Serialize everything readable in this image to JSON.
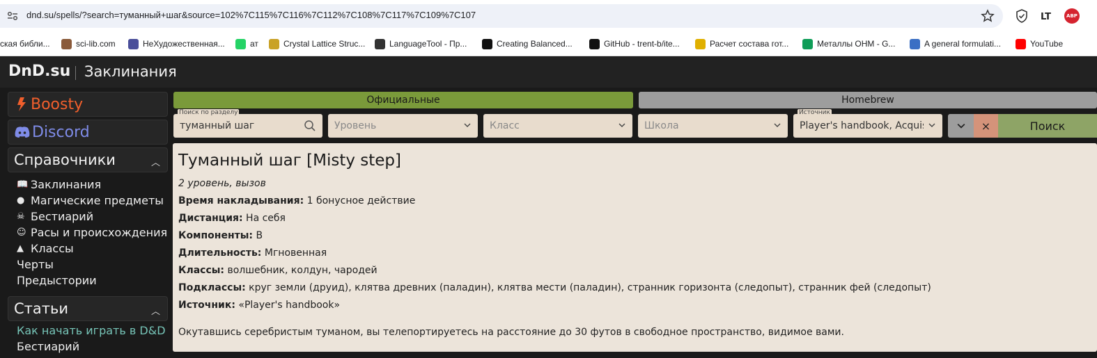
{
  "browser": {
    "url": "dnd.su/spells/?search=туманный+шаг&source=102%7C115%7C116%7C112%7C108%7C117%7C109%7C107",
    "ext_abp": "ABP",
    "bookmarks": [
      {
        "label": "ская библи...",
        "icon": "book-icon",
        "color": "#5b6e86"
      },
      {
        "label": "sci-lib.com",
        "icon": "scilib-icon",
        "color": "#8a5a3a"
      },
      {
        "label": "НеХудожественная...",
        "icon": "nh-icon",
        "color": "#4a4f9a"
      },
      {
        "label": "ат",
        "icon": "whatsapp-icon",
        "color": "#25d366"
      },
      {
        "label": "Crystal Lattice Struc...",
        "icon": "crystal-icon",
        "color": "#c9a227"
      },
      {
        "label": "LanguageTool - Пр...",
        "icon": "languagetool-icon",
        "color": "#333333"
      },
      {
        "label": "Creating Balanced...",
        "icon": "medium-icon",
        "color": "#111111"
      },
      {
        "label": "GitHub - trent-b/ite...",
        "icon": "github-icon",
        "color": "#111111"
      },
      {
        "label": "Расчет состава гот...",
        "icon": "calc-icon",
        "color": "#e0b000"
      },
      {
        "label": "Металлы ОНМ - G...",
        "icon": "sheets-icon",
        "color": "#0f9d58"
      },
      {
        "label": "A general formulati...",
        "icon": "paper-icon",
        "color": "#3b6fc4"
      },
      {
        "label": "YouTube",
        "icon": "youtube-icon",
        "color": "#ff0000"
      }
    ]
  },
  "site": {
    "logo": "DnD.su",
    "page_title": "Заклинания"
  },
  "sidebar": {
    "boosty": "Boosty",
    "discord": "Discord",
    "reference_title": "Справочники",
    "reference_items": [
      {
        "label": "Заклинания",
        "icon": "book-icon"
      },
      {
        "label": "Магические предметы",
        "icon": "potion-icon"
      },
      {
        "label": "Бестиарий",
        "icon": "skull-icon"
      },
      {
        "label": "Расы и происхождения",
        "icon": "race-icon"
      },
      {
        "label": "Классы",
        "icon": "helmet-icon"
      },
      {
        "label": "Черты",
        "icon": ""
      },
      {
        "label": "Предыстории",
        "icon": ""
      }
    ],
    "articles_title": "Статьи",
    "articles_items": [
      {
        "label": "Как начать играть в D&D",
        "accent": true
      },
      {
        "label": "Бестиарий",
        "accent": false
      }
    ]
  },
  "main": {
    "tabs": {
      "official": "Официальные",
      "homebrew": "Homebrew"
    },
    "filters": {
      "search_label": "Поиск по разделу",
      "search_value": "туманный шаг",
      "level_placeholder": "Уровень",
      "class_placeholder": "Класс",
      "school_placeholder": "Школа",
      "source_label": "Источник",
      "source_value": "Player's handbook, Acquisit"
    },
    "buttons": {
      "clear": "×",
      "search": "Поиск"
    },
    "spell": {
      "title": "Туманный шаг [Misty step]",
      "meta": "2 уровень, вызов",
      "props": [
        {
          "label": "Время накладывания:",
          "value": "1 бонусное действие"
        },
        {
          "label": "Дистанция:",
          "value": "На себя"
        },
        {
          "label": "Компоненты:",
          "value": "В"
        },
        {
          "label": "Длительность:",
          "value": "Мгновенная"
        },
        {
          "label": "Классы:",
          "value": "волшебник, колдун, чародей"
        },
        {
          "label": "Подклассы:",
          "value": "круг земли (друид), клятва древних (паладин), клятва мести (паладин), странник горизонта (следопыт), странник фей (следопыт)"
        },
        {
          "label": "Источник:",
          "value": "«Player's handbook»"
        }
      ],
      "description": "Окутавшись серебристым туманом, вы телепортируетесь на расстояние до 30 футов в свободное пространство, видимое вами."
    }
  },
  "colors": {
    "tab_official": "#7a9a3a",
    "tab_homebrew": "#9d9d9d",
    "search_button": "#8ea466",
    "clear_button": "#d4937a",
    "boosty": "#f15f2c",
    "discord": "#7f8ce8",
    "accent_link": "#77c5b8"
  }
}
